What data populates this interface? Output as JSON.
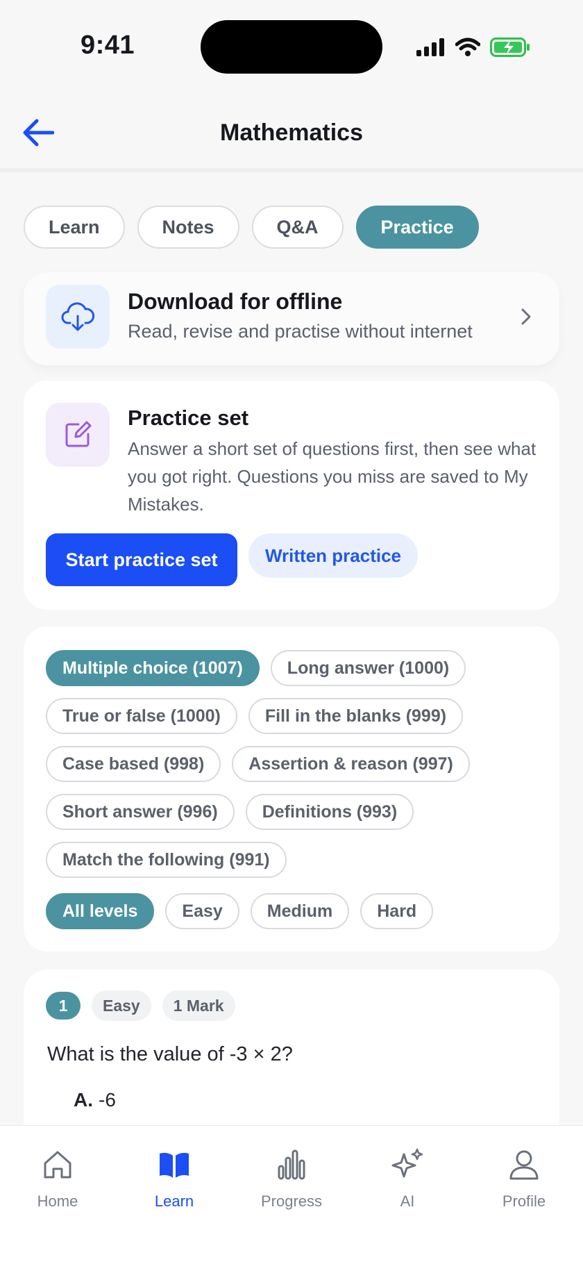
{
  "status_bar": {
    "time": "9:41"
  },
  "header": {
    "title": "Mathematics",
    "back_icon": "arrow-left-icon"
  },
  "tabs": [
    {
      "label": "Learn",
      "active": false
    },
    {
      "label": "Notes",
      "active": false
    },
    {
      "label": "Q&A",
      "active": false
    },
    {
      "label": "Practice",
      "active": true
    }
  ],
  "offline": {
    "title": "Download for offline",
    "subtitle": "Read, revise and practise without internet",
    "icon": "cloud-download-icon"
  },
  "practice_set": {
    "title": "Practice set",
    "description": "Answer a short set of questions first, then see what you got right. Questions you miss are saved to My Mistakes.",
    "primary_button": "Start practice set",
    "secondary_button": "Written practice",
    "icon": "edit-icon"
  },
  "question_types": [
    {
      "label": "Multiple choice (1007)",
      "active": true
    },
    {
      "label": "Long answer (1000)",
      "active": false
    },
    {
      "label": "True or false (1000)",
      "active": false
    },
    {
      "label": "Fill in the blanks (999)",
      "active": false
    },
    {
      "label": "Case based (998)",
      "active": false
    },
    {
      "label": "Assertion & reason (997)",
      "active": false
    },
    {
      "label": "Short answer (996)",
      "active": false
    },
    {
      "label": "Definitions (993)",
      "active": false
    },
    {
      "label": "Match the following (991)",
      "active": false
    }
  ],
  "levels": [
    {
      "label": "All levels",
      "active": true
    },
    {
      "label": "Easy",
      "active": false
    },
    {
      "label": "Medium",
      "active": false
    },
    {
      "label": "Hard",
      "active": false
    }
  ],
  "question": {
    "number": "1",
    "difficulty": "Easy",
    "marks": "1 Mark",
    "text": "What is the value of -3 × 2?",
    "option_letter": "A.",
    "option_text": "-6"
  },
  "bottom_nav": [
    {
      "label": "Home",
      "icon": "home-icon",
      "active": false
    },
    {
      "label": "Learn",
      "icon": "book-icon",
      "active": true
    },
    {
      "label": "Progress",
      "icon": "bar-chart-icon",
      "active": false
    },
    {
      "label": "AI",
      "icon": "sparkles-icon",
      "active": false
    },
    {
      "label": "Profile",
      "icon": "user-icon",
      "active": false
    }
  ],
  "colors": {
    "accent_teal": "#4b93a0",
    "primary_blue": "#1b4ef5",
    "background": "#f7f7f8"
  }
}
